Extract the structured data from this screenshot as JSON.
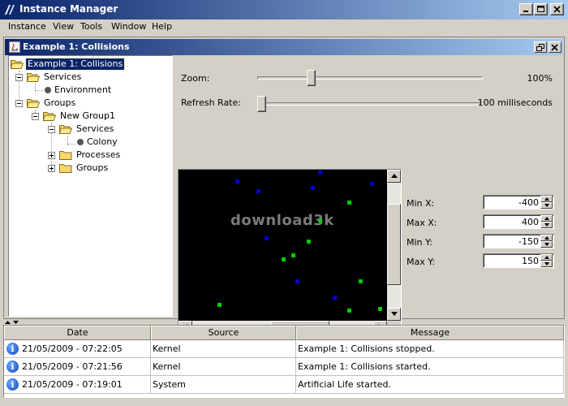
{
  "app": {
    "title": "Instance Manager"
  },
  "menu": [
    "Instance",
    "View",
    "Tools",
    "Window",
    "Help"
  ],
  "frame": {
    "title": "Example 1: Collisions"
  },
  "tree": {
    "root": "Example 1: Collisions",
    "services": "Services",
    "environment": "Environment",
    "groups": "Groups",
    "new_group": "New Group1",
    "sub_services": "Services",
    "colony": "Colony",
    "processes": "Processes",
    "sub_groups": "Groups"
  },
  "controls": {
    "zoom_label": "Zoom:",
    "zoom_value": "100%",
    "zoom_fraction": 0.23,
    "refresh_label": "Refresh Rate:",
    "refresh_value": "100 milliseconds",
    "refresh_fraction": 0.0
  },
  "bounds": {
    "min_x_label": "Min X:",
    "min_x": "-400",
    "max_x_label": "Max X:",
    "max_x": "400",
    "min_y_label": "Min Y:",
    "min_y": "-150",
    "max_y_label": "Max Y:",
    "max_y": "150"
  },
  "watermark": "download3k",
  "colors": {
    "particle_blue": "#0000cc",
    "particle_green": "#00cc00",
    "title_start": "#0a246a",
    "title_end": "#a6caf0"
  },
  "log": {
    "headers": {
      "date": "Date",
      "source": "Source",
      "message": "Message"
    },
    "rows": [
      {
        "icon": "info-icon",
        "date": "21/05/2009 - 07:22:05",
        "source": "Kernel",
        "message": "Example 1: Collisions stopped."
      },
      {
        "icon": "info-icon",
        "date": "21/05/2009 - 07:21:56",
        "source": "Kernel",
        "message": "Example 1: Collisions started."
      },
      {
        "icon": "info-icon",
        "date": "21/05/2009 - 07:19:01",
        "source": "System",
        "message": "Artificial Life started."
      }
    ]
  }
}
